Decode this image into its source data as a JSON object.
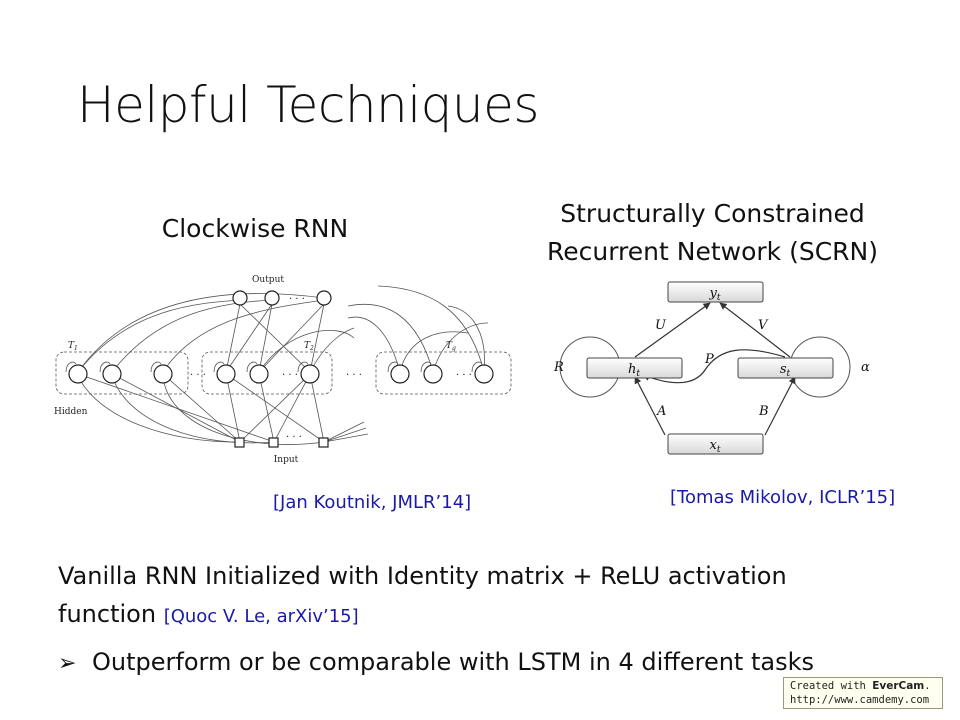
{
  "slide": {
    "title": "Helpful Techniques"
  },
  "left_figure": {
    "heading": "Clockwise RNN",
    "label_output": "Output",
    "label_input": "Input",
    "label_hidden": "Hidden",
    "label_t1": "T",
    "label_t1_sub": "1",
    "label_t2": "T",
    "label_t2_sub": "2",
    "label_tg": "T",
    "label_tg_sub": "g",
    "dots": "· · ·",
    "citation": "[Jan Koutnik, JMLR’14]"
  },
  "right_figure": {
    "heading_line1": "Structurally Constrained",
    "heading_line2": "Recurrent Network (SCRN)",
    "node_y": "y",
    "node_y_sub": "t",
    "node_h": "h",
    "node_h_sub": "t",
    "node_s": "s",
    "node_s_sub": "t",
    "node_x": "x",
    "node_x_sub": "t",
    "edge_U": "U",
    "edge_V": "V",
    "edge_P": "P",
    "edge_A": "A",
    "edge_B": "B",
    "loop_R": "R",
    "loop_alpha": "α",
    "citation": "[Tomas Mikolov, ICLR’15]"
  },
  "body": {
    "line1": "Vanilla RNN Initialized with Identity matrix + ReLU activation",
    "line2": "function",
    "line2_cite": "[Quoc V. Le, arXiv’15]",
    "bullet_symbol": "➢",
    "bullet_text": "Outperform or be comparable with LSTM in 4 different tasks"
  },
  "watermark": {
    "prefix": "Created with ",
    "brand": "EverCam",
    "suffix": ".",
    "url": "http://www.camdemy.com"
  }
}
